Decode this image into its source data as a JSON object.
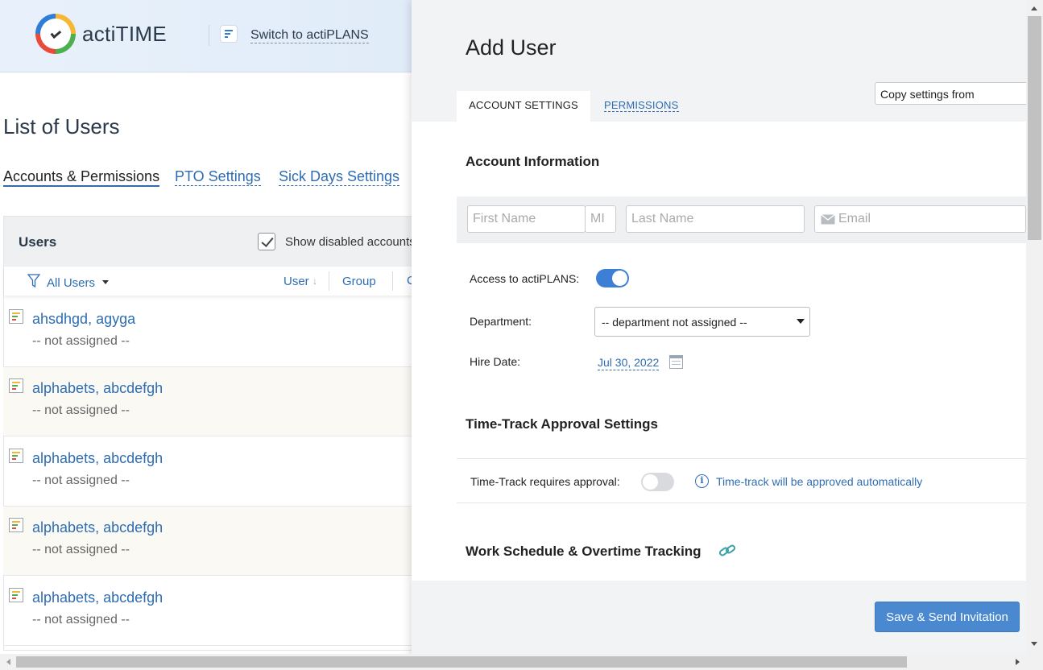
{
  "header": {
    "brand": "actiTIME",
    "switch_link": "Switch to actiPLANS"
  },
  "page": {
    "title": "List of Users",
    "tabs": [
      "Accounts & Permissions",
      "PTO Settings",
      "Sick Days Settings"
    ]
  },
  "users_panel": {
    "title": "Users",
    "show_disabled": "Show disabled accounts",
    "filter": "All Users",
    "columns": {
      "user": "User",
      "sort_arrow": "↓",
      "group": "Group",
      "more": "C"
    },
    "rows": [
      {
        "name": "ahsdhgd, agyga",
        "sub": "-- not assigned --"
      },
      {
        "name": "alphabets, abcdefgh",
        "sub": "-- not assigned --"
      },
      {
        "name": "alphabets, abcdefgh",
        "sub": "-- not assigned --"
      },
      {
        "name": "alphabets, abcdefgh",
        "sub": "-- not assigned --"
      },
      {
        "name": "alphabets, abcdefgh",
        "sub": "-- not assigned --"
      }
    ]
  },
  "modal": {
    "title": "Add User",
    "tabs": {
      "account": "ACCOUNT SETTINGS",
      "permissions": "PERMISSIONS"
    },
    "copy_settings": "Copy settings from",
    "account_info": {
      "heading": "Account Information",
      "first_name_placeholder": "First Name",
      "mi_placeholder": "MI",
      "last_name_placeholder": "Last Name",
      "email_placeholder": "Email",
      "access_label": "Access to actiPLANS:",
      "access_enabled": true,
      "department_label": "Department:",
      "department_value": "-- department not assigned --",
      "hire_date_label": "Hire Date:",
      "hire_date_value": "Jul 30, 2022"
    },
    "time_track": {
      "heading": "Time-Track Approval Settings",
      "requires_label": "Time-Track requires approval:",
      "requires_enabled": false,
      "info": "Time-track will be approved automatically"
    },
    "work_schedule": {
      "heading": "Work Schedule & Overtime Tracking"
    },
    "save_button": "Save & Send Invitation"
  },
  "colors": {
    "accent": "#2e6db3",
    "toggle_on": "#3e7fd6",
    "button": "#4a89d0"
  }
}
